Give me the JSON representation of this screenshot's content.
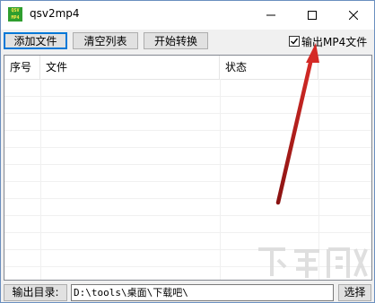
{
  "window": {
    "title": "qsv2mp4",
    "app_icon_text": "QSV MP4",
    "controls": [
      "minimize",
      "maximize",
      "close"
    ]
  },
  "toolbar": {
    "add_file": "添加文件",
    "clear_list": "清空列表",
    "start_convert": "开始转换",
    "output_mp4_label": "输出MP4文件",
    "output_mp4_checked": true
  },
  "list": {
    "columns": [
      "序号",
      "文件",
      "状态"
    ],
    "rows": []
  },
  "bottom": {
    "output_dir_label": "输出目录:",
    "output_dir_value": "D:\\tools\\桌面\\下载吧\\",
    "choose_button": "选择"
  },
  "annotation": {
    "arrow_color": "#c0201e"
  },
  "icons": {
    "app": "qsv-mp4-icon",
    "minimize": "minimize-icon",
    "maximize": "maximize-icon",
    "close": "close-icon",
    "checkbox": "checkbox-checked-icon"
  }
}
